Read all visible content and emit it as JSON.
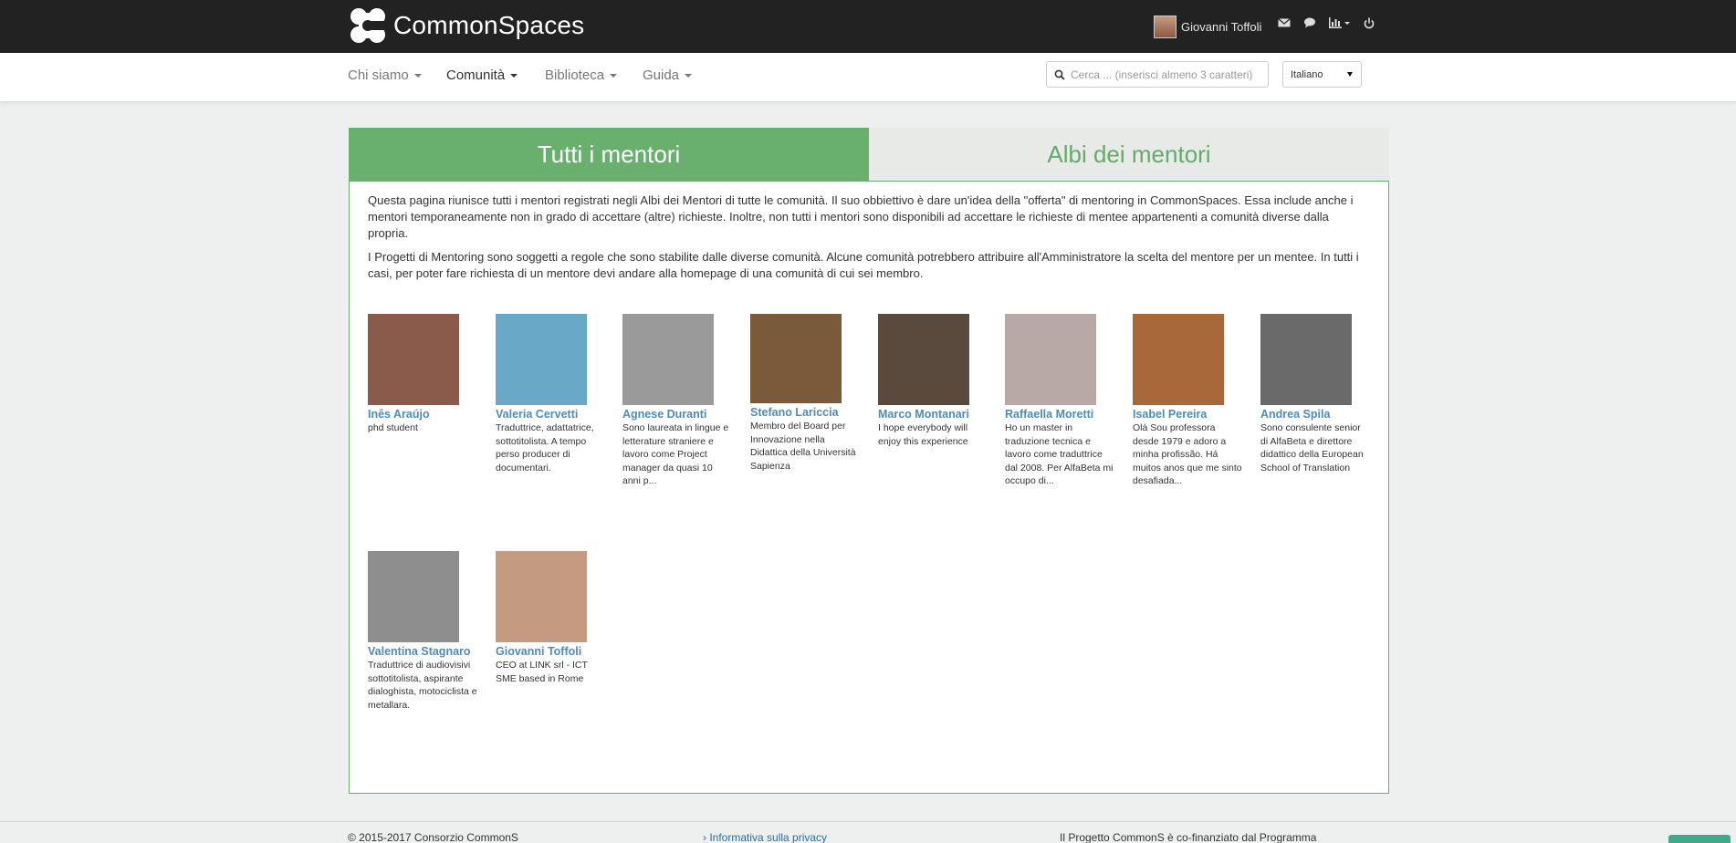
{
  "brand": {
    "name": "CommonSpaces"
  },
  "user": {
    "name": "Giovanni Toffoli"
  },
  "nav": {
    "items": [
      {
        "label": "Chi siamo"
      },
      {
        "label": "Comunità"
      },
      {
        "label": "Biblioteca"
      },
      {
        "label": "Guida"
      }
    ],
    "search_placeholder": "Cerca ... (inserisci almeno 3 caratteri)",
    "language": "Italiano"
  },
  "tabs": {
    "active": "Tutti i mentori",
    "inactive": "Albi dei mentori"
  },
  "intro": {
    "p1": "Questa pagina riunisce tutti i mentori registrati negli Albi dei Mentori di tutte le comunità. Il suo obbiettivo è dare un'idea della \"offerta\" di mentoring in CommonSpaces. Essa include anche i mentori temporaneamente non in grado di accettare (altre) richieste. Inoltre, non tutti i mentori sono disponibili ad accettare le richieste di mentee appartenenti a comunità diverse dalla propria.",
    "p2": "I Progetti di Mentoring sono soggetti a regole che sono stabilite dalle diverse comunità. Alcune comunità potrebbero attribuire all'Amministratore la scelta del mentore per un mentee. In tutti i casi, per poter fare richiesta di un mentore devi andare alla homepage di una comunità di cui sei membro."
  },
  "mentors": [
    {
      "name": "Inês Araújo",
      "bio": "phd student",
      "photo_color": "#8a5a4a"
    },
    {
      "name": "Valeria Cervetti",
      "bio": "Traduttrice, adattatrice, sottotitolista. A tempo perso producer di documentari.",
      "photo_color": "#6aa8c8"
    },
    {
      "name": "Agnese Duranti",
      "bio": "Sono laureata in lingue e letterature straniere e lavoro come Project manager da quasi 10 anni p...",
      "photo_color": "#9a9a9a"
    },
    {
      "name": "Stefano Lariccia",
      "bio": "Membro del Board per Innovazione nella Didattica della Università Sapienza",
      "photo_color": "#7a5a3a"
    },
    {
      "name": "Marco Montanari",
      "bio": "I hope everybody will enjoy this experience",
      "photo_color": "#5a4a3e"
    },
    {
      "name": "Raffaella Moretti",
      "bio": "Ho un master in traduzione tecnica e lavoro come traduttrice dal 2008. Per AlfaBeta mi occupo di...",
      "photo_color": "#b8a8a6"
    },
    {
      "name": "Isabel Pereira",
      "bio": "Olá Sou professora desde 1979 e adoro a minha profissão. Há muitos anos que me sinto desafiada...",
      "photo_color": "#a8683a"
    },
    {
      "name": "Andrea Spila",
      "bio": "Sono consulente senior di AlfaBeta e direttore didattico della European School of Translation",
      "photo_color": "#6a6a6a"
    },
    {
      "name": "Valentina Stagnaro",
      "bio": "Traduttrice di audiovisivi sottotitolista, aspirante dialoghista, motociclista e metallara.",
      "photo_color": "#8e8e8e"
    },
    {
      "name": "Giovanni Toffoli",
      "bio": "CEO at LINK srl - ICT SME based in Rome",
      "photo_color": "#c49a80"
    }
  ],
  "footer": {
    "copyright": "© 2015-2017 Consorzio CommonS",
    "privacy": "Informativa sulla privacy",
    "funding": "Il Progetto CommonS è co-finanziato dal Programma"
  }
}
